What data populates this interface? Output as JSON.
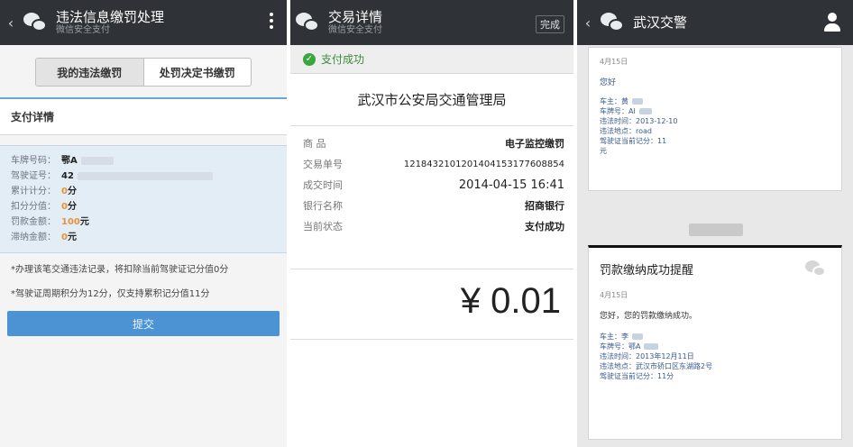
{
  "panel1": {
    "title": "违法信息缴罚处理",
    "subtitle": "微信安全支付",
    "back_glyph": "‹",
    "tabs": [
      "我的违法缴罚",
      "处罚决定书缴罚"
    ],
    "section_title": "支付详情",
    "rows": [
      {
        "k": "车牌号码：",
        "v": "鄂A",
        "hl": ""
      },
      {
        "k": "驾驶证号：",
        "v": "42",
        "hl": ""
      },
      {
        "k": "累计计分：",
        "v": "分",
        "hl": "0"
      },
      {
        "k": "扣分分值：",
        "v": "分",
        "hl": "0"
      },
      {
        "k": "罚款金额：",
        "v": "元",
        "hl": "100"
      },
      {
        "k": "滞纳金额：",
        "v": "元",
        "hl": "0"
      }
    ],
    "note1": "*办理该笔交通违法记录，将扣除当前驾驶证记分值0分",
    "note2": "*驾驶证周期积分为12分，仅支持累积记分值11分",
    "submit_label": "提交"
  },
  "panel2": {
    "title": "交易详情",
    "subtitle": "微信安全支付",
    "done_label": "完成",
    "success_label": "支付成功",
    "payee": "武汉市公安局交通管理局",
    "rows": [
      {
        "k": "商    品",
        "v": "电子监控缴罚"
      },
      {
        "k": "交易单号",
        "v": "1218432101201404153177608854"
      },
      {
        "k": "成交时间",
        "v": "2014-04-15 16:41"
      },
      {
        "k": "银行名称",
        "v": "招商银行"
      },
      {
        "k": "当前状态",
        "v": "支付成功"
      }
    ],
    "amount": "¥ 0.01"
  },
  "panel3": {
    "title": "武汉交警",
    "back_glyph": "‹",
    "card1": {
      "date": "4月15日",
      "greet": "您好",
      "rows": [
        "车主：黄",
        "车牌号：AI",
        "违法时间：2013-12-10",
        "违法地点：road",
        "驾驶证当前记分：11",
        "元"
      ]
    },
    "card2": {
      "title": "罚款缴纳成功提醒",
      "date": "4月15日",
      "greet": "您好，您的罚款缴纳成功。",
      "rows": [
        "车主：李",
        "车牌号：鄂A",
        "违法时间：2013年12月11日",
        "违法地点：武汉市硚口区东湖路2号",
        "驾驶证当前记分：11分"
      ]
    }
  },
  "colors": {
    "titlebar": "#2f3338",
    "submit_blue": "#4c93d4",
    "success_green": "#3aa63e",
    "highlight_orange": "#e8913c"
  },
  "icons": [
    "back-chevron-icon",
    "wechat-icon",
    "more-menu-icon",
    "check-circle-icon",
    "user-profile-icon"
  ]
}
